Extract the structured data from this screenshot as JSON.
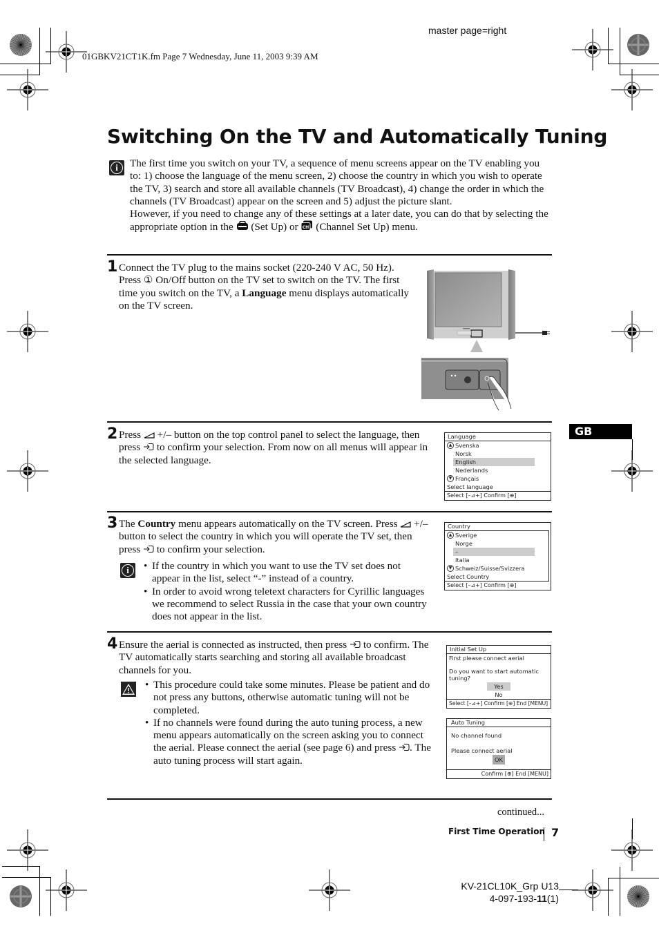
{
  "header": {
    "file_info": "01GBKV21CT1K.fm  Page 7  Wednesday, June 11, 2003  9:39 AM",
    "master_page": "master page=right"
  },
  "page": {
    "title": "Switching On the TV and Automatically Tuning",
    "language_tab": "GB",
    "intro": {
      "icon": "info-icon",
      "paragraph1": "The first time you switch on your TV, a sequence of menu screens appear on the TV enabling you to: 1) choose the language of the menu screen, 2) choose the country in which you wish to operate the TV, 3) search and store all available channels (TV Broadcast), 4) change the order in which the channels (TV Broadcast) appear on the screen and 5) adjust the picture slant.",
      "paragraph2_pre": "However, if you need to change any of these settings at a later date, you can do that by selecting the appropriate option in the",
      "setup_label": "(Set Up) or",
      "channel_setup_label": "(Channel Set Up) menu.",
      "setup_icon": "setup-toolbox-icon",
      "channel_setup_icon": "channel-setup-icon"
    },
    "steps": [
      {
        "number": "1",
        "text_pre": "Connect the TV plug to the mains socket (220-240 V AC, 50 Hz). Press ",
        "power_symbol": "①",
        "text_mid": " On/Off button on the TV set to switch on the TV. The first time you switch on the TV, a ",
        "bold": "Language",
        "text_post": " menu displays automatically on the TV screen."
      },
      {
        "number": "2",
        "text_pre": "Press ",
        "text_mid": " +/– button on the top control panel to select the language, then press ",
        "text_post": " to confirm your selection. From now on all menus will appear in the selected language."
      },
      {
        "number": "3",
        "text_pre": "The ",
        "bold": "Country",
        "text_mid": " menu appears automatically on the TV screen. Press ",
        "text_mid2": " +/– button to select the country in which you will operate the TV set, then press ",
        "text_post": " to confirm your selection.",
        "notes": [
          "If the country in which you want to use the TV set does not appear in the list, select “-” instead of a country.",
          "In order to avoid wrong teletext characters for Cyrillic languages we recommend to select Russia in the case that your own country does not appear in the list."
        ]
      },
      {
        "number": "4",
        "text_pre": "Ensure the aerial is connected as instructed, then press ",
        "text_post": " to confirm. The TV automatically starts searching and storing all available broadcast channels for you.",
        "notes": [
          "This procedure could take some minutes. Please be patient and do not press any buttons, otherwise automatic tuning will not be completed.",
          "If no channels were found during the auto tuning process, a new menu appears automatically on the screen asking you to connect the aerial. Please connect the aerial (see page 6) and press ⊕. The auto tuning process will start again."
        ],
        "note2_pre": "If no channels were found during the auto tuning process, a new menu appears automatically on the screen asking you to connect the aerial. Please connect the aerial (see page 6) and press ",
        "note2_post": ". The auto tuning process will start again."
      }
    ],
    "menus": {
      "language": {
        "title": "Language",
        "items": [
          "Svenska",
          "Norsk",
          "English",
          "Nederlands",
          "Français"
        ],
        "selected": "English",
        "prompt": "Select language",
        "footer": "Select [–⊿+]  Confirm [⊕]"
      },
      "country": {
        "title": "Country",
        "items": [
          "Sverige",
          "Norge",
          "–",
          "Italia",
          "Schweiz/Suisse/Svizzera"
        ],
        "selected": "–",
        "prompt": "Select Country",
        "footer": "Select [–⊿+]  Confirm [⊕]"
      },
      "initial_setup": {
        "title": "Initial Set Up",
        "line1": "First please connect aerial",
        "line2": "Do you want to start automatic",
        "line3": "tuning?",
        "options": [
          "Yes",
          "No"
        ],
        "selected": "Yes",
        "footer": "Select [–⊿+]  Confirm [⊕]  End [MENU]"
      },
      "auto_tuning": {
        "title": "Auto Tuning",
        "line1": "No channel found",
        "line2": "Please connect aerial",
        "button": "OK",
        "footer": "Confirm [⊕]  End [MENU]"
      }
    },
    "continued": "continued...",
    "footer_section": "First Time Operation",
    "page_number": "7"
  },
  "footer": {
    "model": "KV-21CL10K_Grp U13",
    "part_number_pre": "4-097-193-",
    "part_number_bold": "11",
    "part_number_post": "(1)"
  },
  "icons": {
    "power": "power-icon",
    "volume_ramp": "volume-ramp-icon",
    "enter": "enter-icon",
    "warning": "warning-icon",
    "menu_up": "scroll-up-icon",
    "menu_down": "scroll-down-icon"
  }
}
